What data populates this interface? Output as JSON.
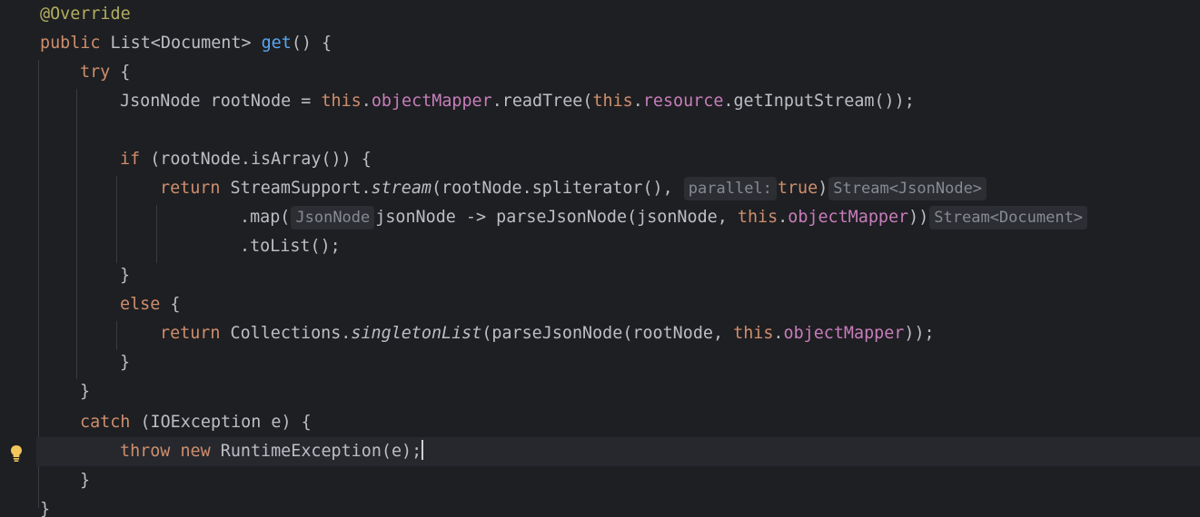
{
  "editor": {
    "language": "java",
    "colors": {
      "background": "#1e1f22",
      "current_line": "#26282e",
      "keyword": "#cf8e6d",
      "annotation": "#b3ae60",
      "method_decl": "#56a8f5",
      "field": "#c77dbb",
      "default_text": "#bcbec4",
      "inlay_hint_bg": "#2c2e33",
      "inlay_hint_fg": "#868a91"
    },
    "gutter_icon": "lightbulb-icon",
    "lines": [
      {
        "tokens": [
          "@Override"
        ]
      },
      {
        "tokens": [
          "public",
          " List<Document> ",
          "get",
          "() {"
        ]
      },
      {
        "tokens": [
          "try",
          " {"
        ]
      },
      {
        "tokens": [
          "JsonNode rootNode = ",
          "this",
          ".",
          "objectMapper",
          ".readTree(",
          "this",
          ".",
          "resource",
          ".getInputStream());"
        ]
      },
      {
        "tokens": []
      },
      {
        "tokens": [
          "if",
          " (rootNode.isArray()) {"
        ]
      },
      {
        "tokens": [
          "return",
          " StreamSupport.",
          "stream",
          "(rootNode.spliterator(), ",
          "parallel:",
          "true",
          ")",
          "Stream<JsonNode>"
        ]
      },
      {
        "tokens": [
          ".map(",
          "JsonNode",
          "jsonNode -> parseJsonNode(jsonNode, ",
          "this",
          ".",
          "objectMapper",
          "))",
          "Stream<Document>"
        ]
      },
      {
        "tokens": [
          ".toList();"
        ]
      },
      {
        "tokens": [
          "}"
        ]
      },
      {
        "tokens": [
          "else",
          " {"
        ]
      },
      {
        "tokens": [
          "return",
          " Collections.",
          "singletonList",
          "(parseJsonNode(rootNode, ",
          "this",
          ".",
          "objectMapper",
          "));"
        ]
      },
      {
        "tokens": [
          "}"
        ]
      },
      {
        "tokens": [
          "}"
        ]
      },
      {
        "tokens": [
          "catch",
          " (IOException e) {"
        ]
      },
      {
        "tokens": [
          "throw",
          " ",
          "new",
          " RuntimeException(e);"
        ]
      },
      {
        "tokens": [
          "}"
        ]
      },
      {
        "tokens": [
          "}"
        ]
      }
    ]
  }
}
